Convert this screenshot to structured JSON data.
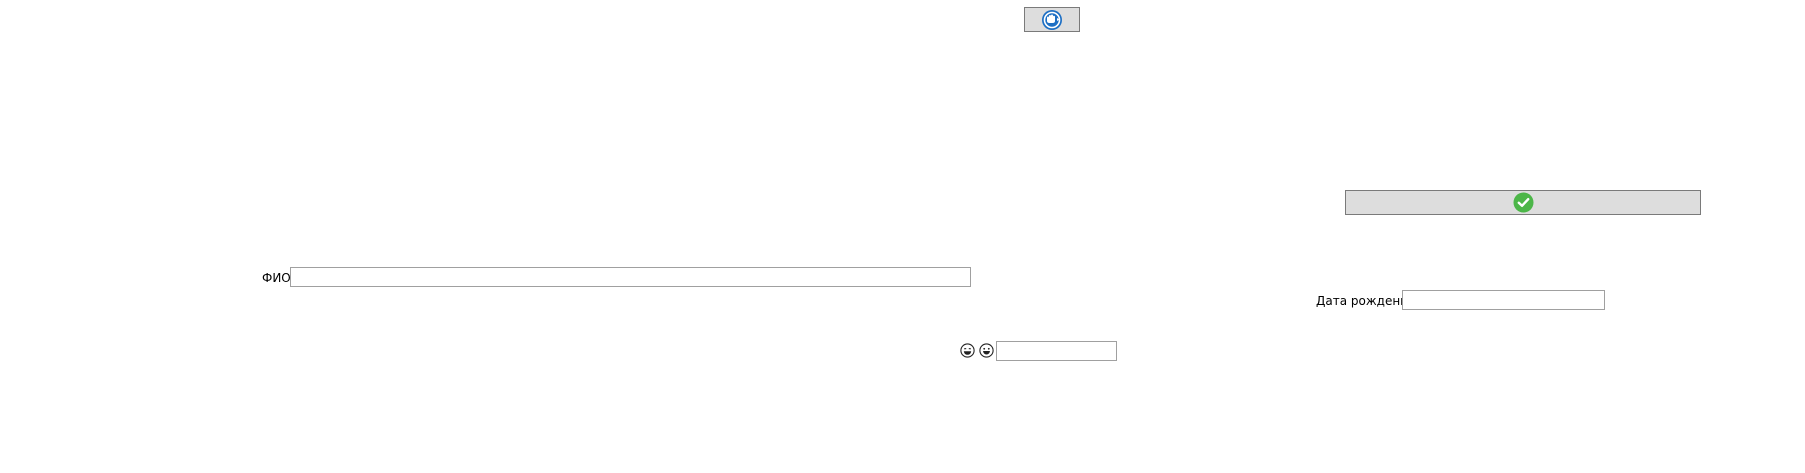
{
  "top_button": {
    "icon": "blue-circle-refresh-hand-icon",
    "color": "#1d6fc4"
  },
  "confirm_button": {
    "icon": "green-check-circle-icon",
    "color": "#4cb648"
  },
  "fio": {
    "label": "ФИО",
    "value": ""
  },
  "birthdate": {
    "label": "Дата рождения",
    "value": ""
  },
  "emoji_field": {
    "icons": [
      "grinning-face-icon",
      "smiling-face-icon"
    ],
    "value": ""
  }
}
